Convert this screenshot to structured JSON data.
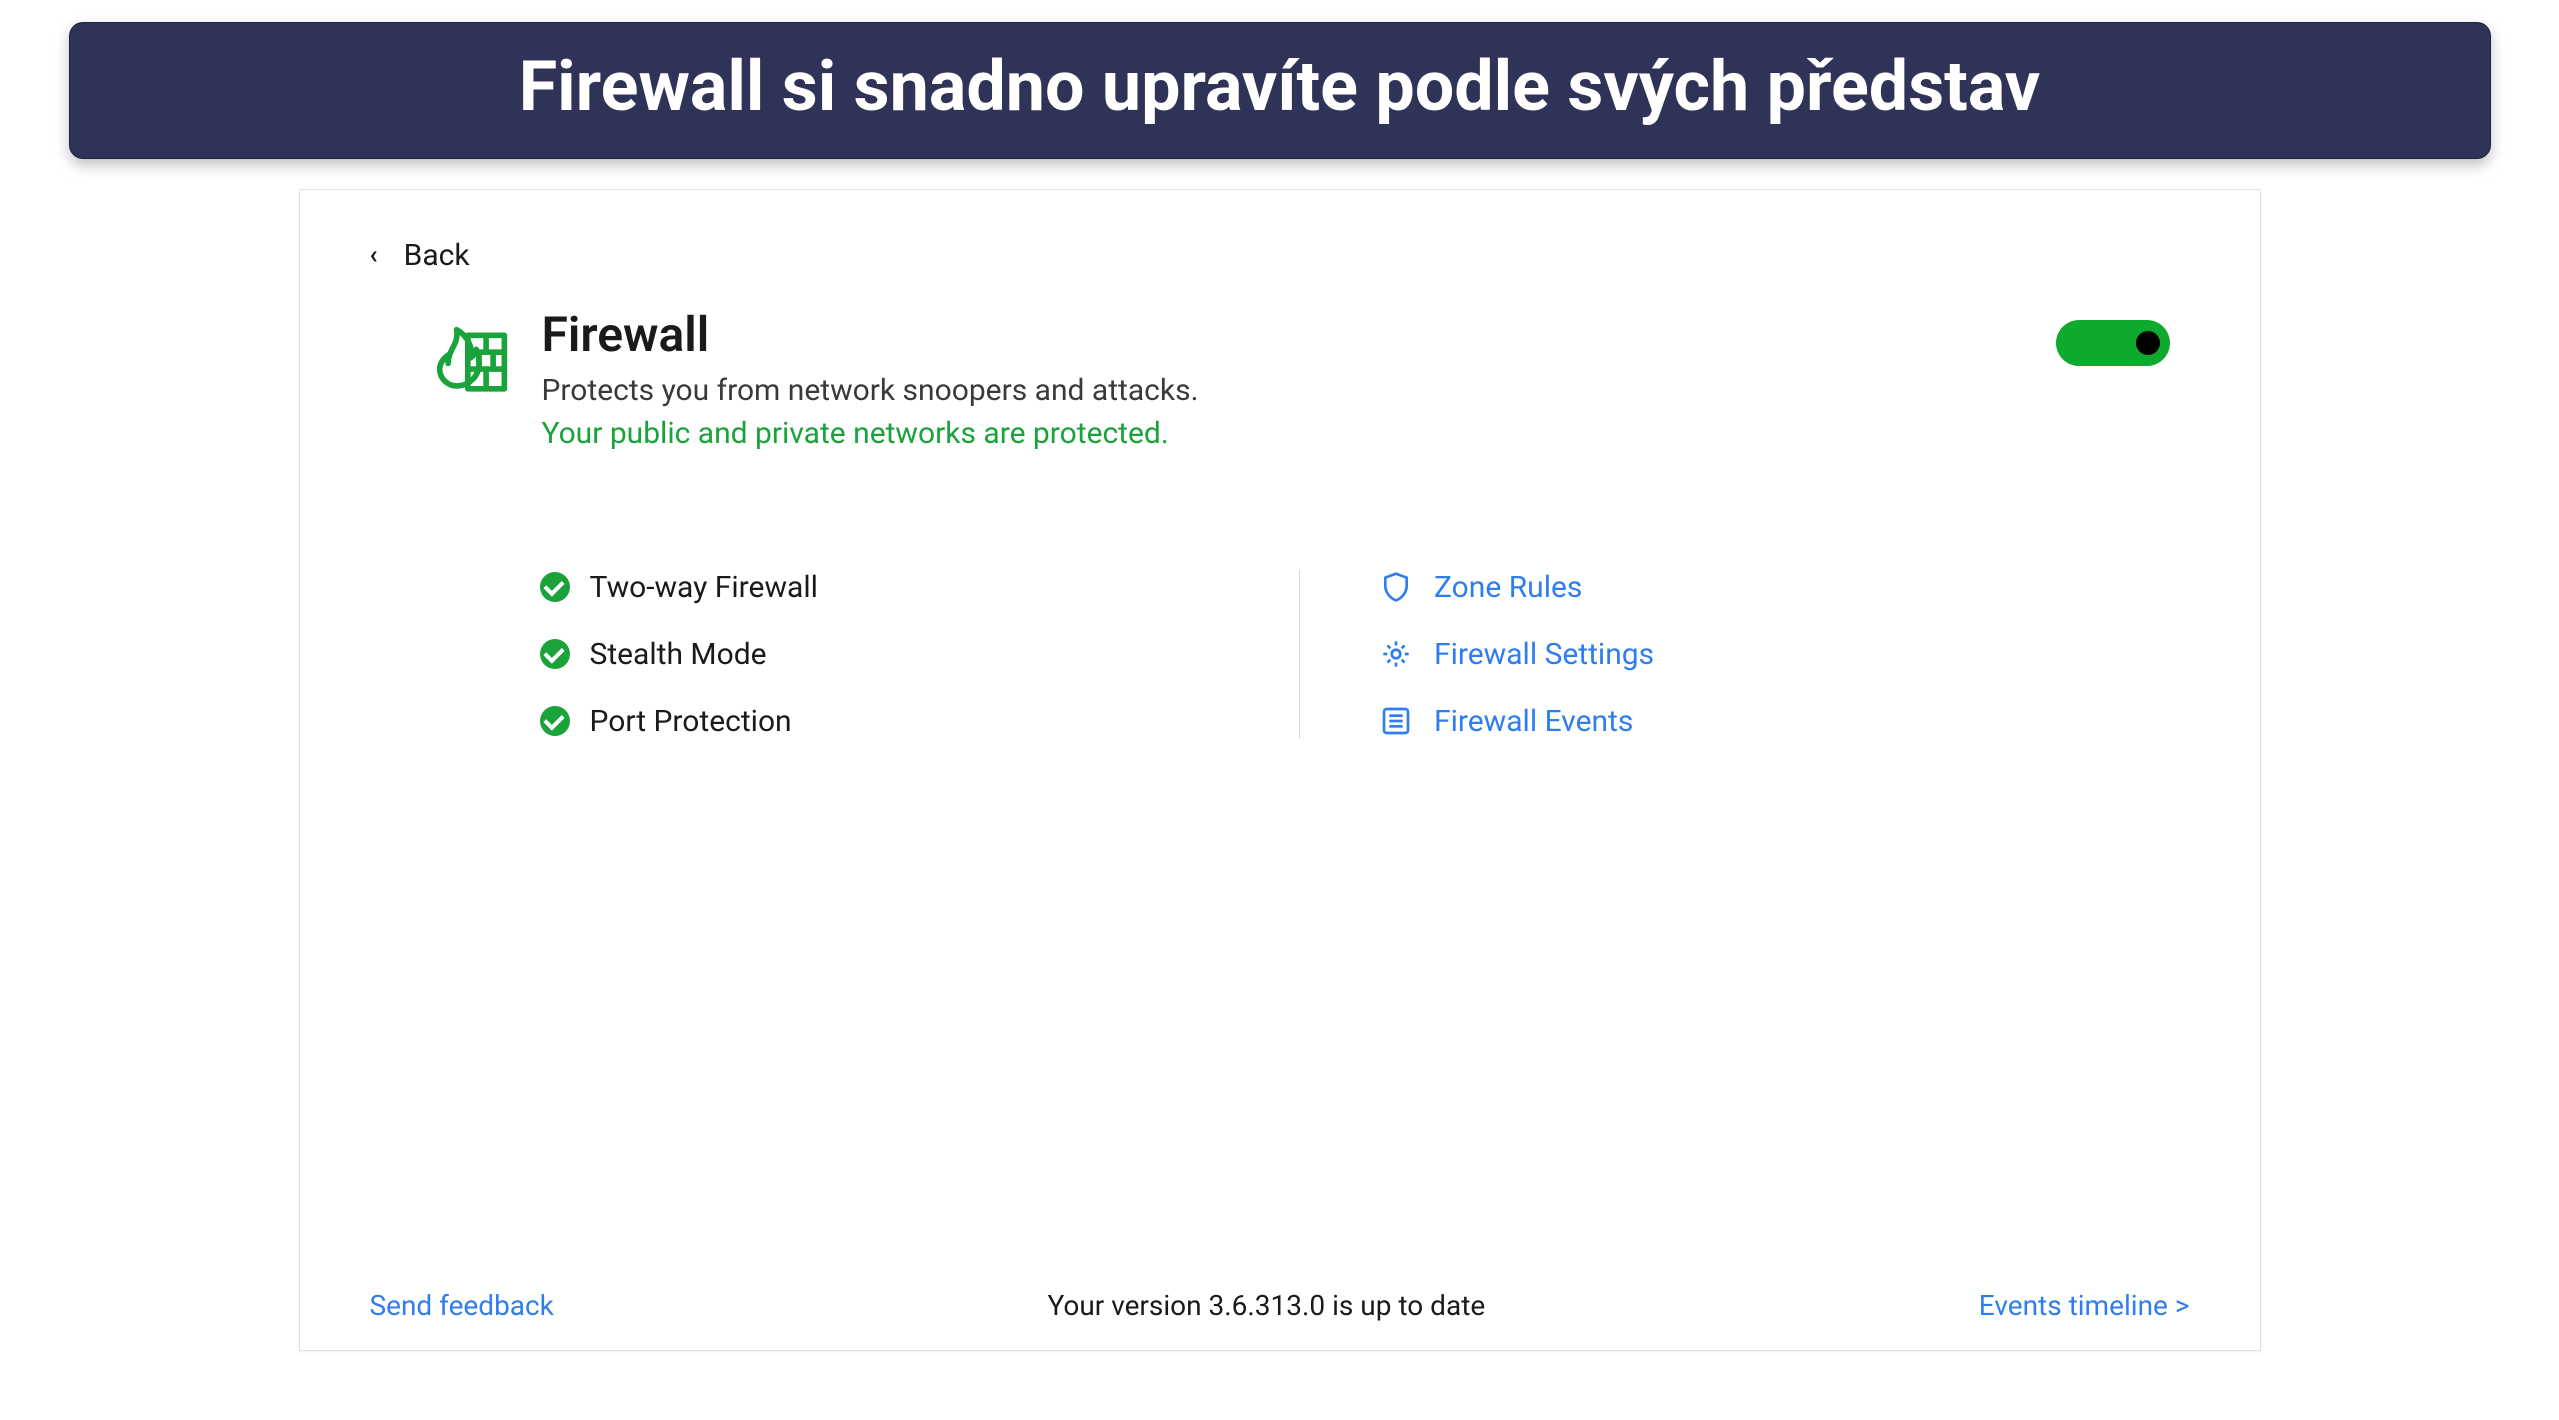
{
  "banner": {
    "text": "Firewall si snadno upravíte podle svých představ"
  },
  "back_label": "Back",
  "firewall": {
    "title": "Firewall",
    "subtitle": "Protects you from network snoopers and attacks.",
    "status_text": "Your public and private networks are protected.",
    "enabled": true
  },
  "features": [
    {
      "label": "Two-way Firewall"
    },
    {
      "label": "Stealth Mode"
    },
    {
      "label": "Port Protection"
    }
  ],
  "links": [
    {
      "label": "Zone Rules",
      "icon": "shield-outline-icon"
    },
    {
      "label": "Firewall Settings",
      "icon": "gear-icon"
    },
    {
      "label": "Firewall Events",
      "icon": "list-icon"
    }
  ],
  "footer": {
    "feedback": "Send feedback",
    "version": "Your version 3.6.313.0 is up to date",
    "events": "Events timeline >"
  },
  "colors": {
    "banner_bg": "#2f3357",
    "accent_green": "#19a33a",
    "toggle_green": "#0eaa2d",
    "link_blue": "#2f7df0"
  }
}
